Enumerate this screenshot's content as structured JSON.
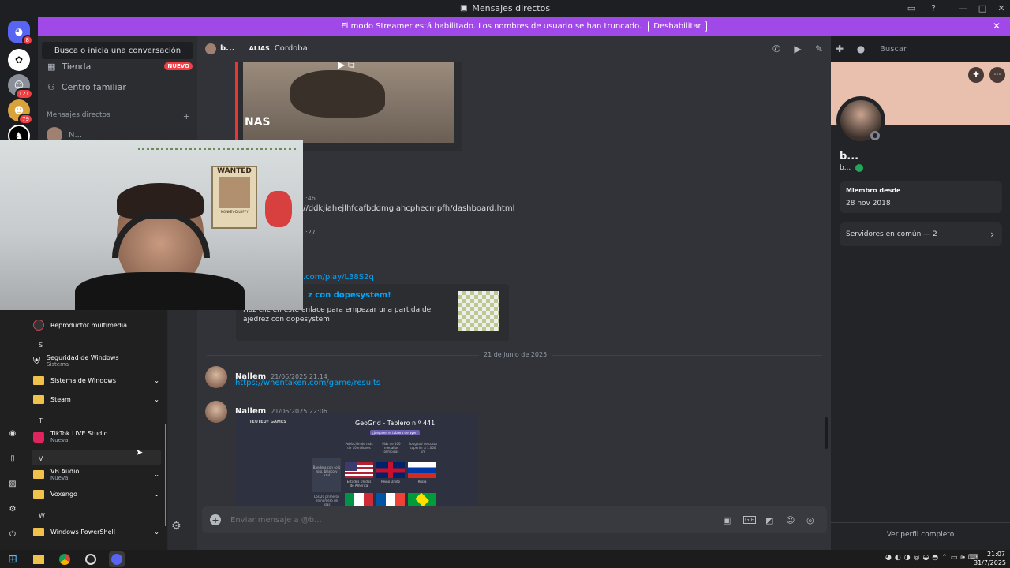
{
  "window": {
    "title": "Mensajes directos"
  },
  "banner": {
    "text": "El modo Streamer está habilitado. Los nombres de usuario se han truncado.",
    "button": "Deshabilitar"
  },
  "servers": [
    {
      "icon": "discord-home-icon",
      "badge": "8"
    },
    {
      "icon": "server-icon",
      "badge": ""
    },
    {
      "icon": "server-icon",
      "badge": "121"
    },
    {
      "icon": "server-icon",
      "badge": "79"
    },
    {
      "icon": "server-icon",
      "badge": ""
    }
  ],
  "sidebar": {
    "search": "Busca o inicia una conversación",
    "shop": "Tienda",
    "shop_badge": "NUEVO",
    "family": "Centro familiar",
    "dm_header": "Mensajes directos",
    "dm_user": "N..."
  },
  "header": {
    "user": "b...",
    "alias_label": "ALIAS",
    "alias": "Cordoba",
    "search_placeholder": "Buscar"
  },
  "chat": {
    "embed_text": "NAS",
    "partial_link1": "//ddkjiahejlhfcafbddmgiahcphecmpfh/dashboard.html",
    "partial_time1": ":46",
    "partial_time2": ":27",
    "partial_link2": ".com/play/L38S2q",
    "partial_text": ") :)",
    "chess_embed": {
      "title": "z con dopesystem!",
      "desc": "Haz clic en este enlace para empezar una partida de ajedrez con dopesystem"
    },
    "date_divider": "21 de junio de 2025",
    "messages": [
      {
        "author": "Nallem",
        "time": "21/06/2025 21:14",
        "link": "https://whentaken.com/game/results"
      },
      {
        "author": "Nallem",
        "time": "21/06/2025 22:06"
      }
    ],
    "geogrid": {
      "brand": "TEUTEUF GAMES",
      "title": "GeoGrid - Tablero n.º 441",
      "subtitle": "¡Juega en el tablero de ayer!",
      "col_headers": [
        "Población de más de 10 millones",
        "Más de 100 medallas olímpicas",
        "Longitud de costa superior a 1.000 km"
      ],
      "row_headers": [
        "Bandera con solo rojo, blanco y azul",
        "Los 20 primeros en número de islas"
      ],
      "row1": [
        "Estados Unidos de América",
        "Reino Unido",
        "Rusia"
      ]
    },
    "input_placeholder": "Enviar mensaje a @b..."
  },
  "profile": {
    "name": "b...",
    "username": "b...",
    "member_since_label": "Miembro desde",
    "member_since": "28 nov 2018",
    "mutual_servers": "Servidores en común — 2",
    "full_profile": "Ver perfil completo"
  },
  "startmenu": {
    "items": [
      {
        "type": "app",
        "label": "Reproductor multimedia",
        "sub": ""
      },
      {
        "type": "letter",
        "label": "S"
      },
      {
        "type": "app",
        "label": "Seguridad de Windows",
        "sub": "Sistema"
      },
      {
        "type": "folder",
        "label": "Sistema de Windows",
        "sub": ""
      },
      {
        "type": "folder",
        "label": "Steam",
        "sub": ""
      },
      {
        "type": "letter",
        "label": "T"
      },
      {
        "type": "app",
        "label": "TikTok LIVE Studio",
        "sub": "Nueva"
      },
      {
        "type": "letter",
        "label": "V"
      },
      {
        "type": "folder",
        "label": "VB Audio",
        "sub": "Nueva"
      },
      {
        "type": "folder",
        "label": "Voxengo",
        "sub": ""
      },
      {
        "type": "letter",
        "label": "W"
      },
      {
        "type": "folder",
        "label": "Windows PowerShell",
        "sub": ""
      }
    ]
  },
  "webcam": {
    "poster_text": "WANTED",
    "poster_name": "MONKEY·D·LUFFY"
  },
  "taskbar": {
    "time": "21:07",
    "date": "31/7/2025"
  },
  "colors": {
    "accent": "#a148e9",
    "link": "#00a8fc",
    "discord_blurple": "#5865f2",
    "badge_red": "#f23f43",
    "profile_banner": "#e9bfae"
  }
}
